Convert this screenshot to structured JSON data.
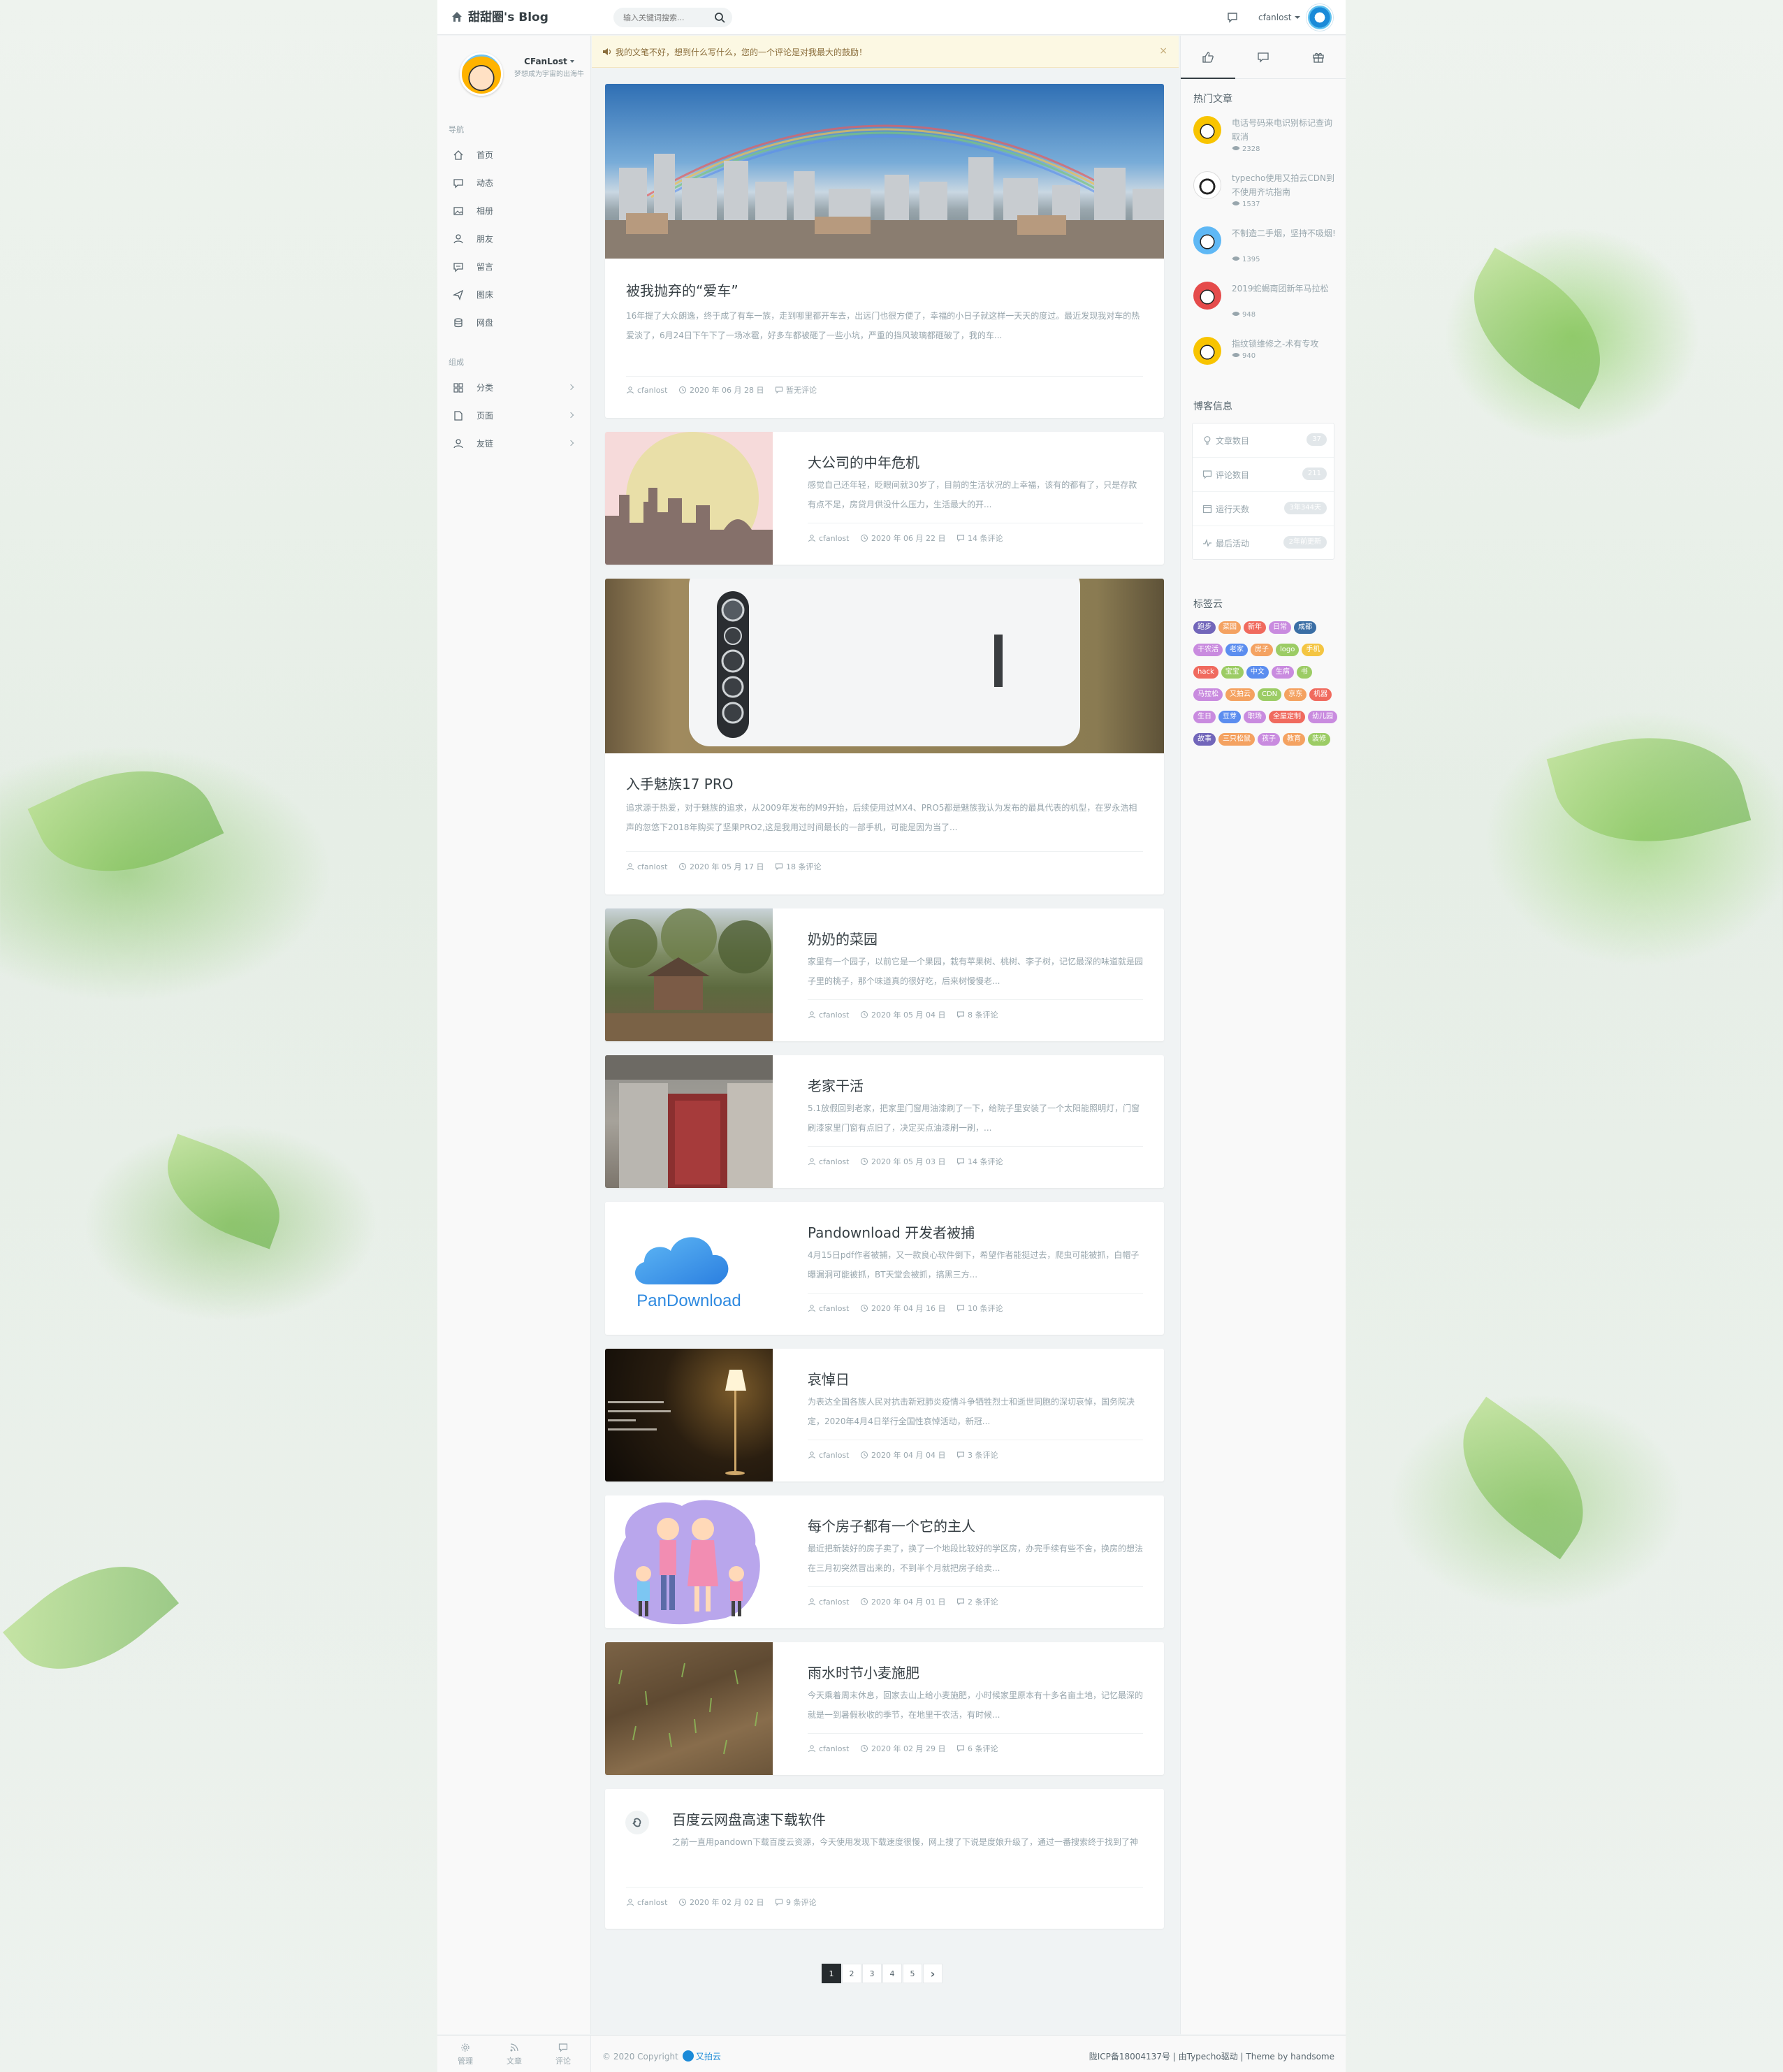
{
  "header": {
    "brand": "甜甜圈's Blog",
    "search_placeholder": "输入关键词搜索...",
    "user": "cfanlost"
  },
  "profile": {
    "name": "CFanLost",
    "bio": "梦想成为宇宙的出海牛"
  },
  "nav": {
    "section1": "导航",
    "items": [
      {
        "label": "首页",
        "icon": "home-icon"
      },
      {
        "label": "动态",
        "icon": "chat-icon"
      },
      {
        "label": "相册",
        "icon": "image-icon"
      },
      {
        "label": "朋友",
        "icon": "user-icon"
      },
      {
        "label": "留言",
        "icon": "bulb-icon"
      },
      {
        "label": "图床",
        "icon": "send-icon"
      },
      {
        "label": "网盘",
        "icon": "database-icon"
      }
    ],
    "section2": "组成",
    "groups": [
      {
        "label": "分类",
        "icon": "grid-icon"
      },
      {
        "label": "页面",
        "icon": "file-icon"
      },
      {
        "label": "友链",
        "icon": "user-icon"
      }
    ]
  },
  "notice": {
    "text": "我的文笔不好，想到什么写什么，您的一个评论是对我最大的鼓励！",
    "close": "×"
  },
  "posts": [
    {
      "title": "被我抛弃的“爱车”",
      "summary": "16年提了大众朗逸，终于成了有车一族，走到哪里都开车去，出远门也很方便了，幸福的小日子就这样一天天的度过。最近发现我对车的热爱淡了，6月24日下午下了一场冰雹，好多车都被砸了一些小坑，严重的挡风玻璃都砸破了，我的车...",
      "author": "cfanlost",
      "date": "2020 年 06 月 28 日",
      "comments": "暂无评论"
    },
    {
      "title": "大公司的中年危机",
      "summary": "感觉自己还年轻，眨眼间就30岁了，目前的生活状况的上幸福，该有的都有了，只是存款有点不足，房贷月供没什么压力，生活最大的开...",
      "author": "cfanlost",
      "date": "2020 年 06 月 22 日",
      "comments": "14 条评论"
    },
    {
      "title": "入手魅族17 PRO",
      "summary": "追求源于热爱，对于魅族的追求，从2009年发布的M9开始，后续使用过MX4、PRO5都是魅族我认为发布的最具代表的机型，在罗永浩相声的忽悠下2018年购买了坚果PRO2,这是我用过时间最长的一部手机，可能是因为当了...",
      "author": "cfanlost",
      "date": "2020 年 05 月 17 日",
      "comments": "18 条评论"
    },
    {
      "title": "奶奶的菜园",
      "summary": "家里有一个园子，以前它是一个果园，栽有苹果树、桃树、李子树，记忆最深的味道就是园子里的桃子，那个味道真的很好吃，后来树慢慢老...",
      "author": "cfanlost",
      "date": "2020 年 05 月 04 日",
      "comments": "8 条评论"
    },
    {
      "title": "老家干活",
      "summary": "5.1放假回到老家，把家里门窗用油漆刷了一下，给院子里安装了一个太阳能照明灯，门窗刷漆家里门窗有点旧了，决定买点油漆刷一刷，...",
      "author": "cfanlost",
      "date": "2020 年 05 月 03 日",
      "comments": "14 条评论"
    },
    {
      "title": "Pandownload 开发者被捕",
      "summary": "4月15日pdf作者被捕，又一款良心软件倒下，希望作者能挺过去，爬虫可能被抓，白帽子曝漏洞可能被抓，BT天堂会被抓，搞黑三方...",
      "author": "cfanlost",
      "date": "2020 年 04 月 16 日",
      "comments": "10 条评论",
      "thumb_text": "PanDownload"
    },
    {
      "title": "哀悼日",
      "summary": "为表达全国各族人民对抗击新冠肺炎疫情斗争牺牲烈士和逝世同胞的深切哀悼，国务院决定，2020年4月4日举行全国性哀悼活动，新冠...",
      "author": "cfanlost",
      "date": "2020 年 04 月 04 日",
      "comments": "3 条评论"
    },
    {
      "title": "每个房子都有一个它的主人",
      "summary": "最近把新装好的房子卖了，换了一个地段比较好的学区房，办完手续有些不舍，换房的想法在三月初突然冒出来的，不到半个月就把房子给卖...",
      "author": "cfanlost",
      "date": "2020 年 04 月 01 日",
      "comments": "2 条评论"
    },
    {
      "title": "雨水时节小麦施肥",
      "summary": "今天乘着周末休息，回家去山上给小麦施肥，小时候家里原本有十多名亩土地，记忆最深的就是一到暑假秋收的季节，在地里干农活，有时候...",
      "author": "cfanlost",
      "date": "2020 年 02 月 29 日",
      "comments": "6 条评论"
    },
    {
      "title": "百度云网盘高速下载软件",
      "summary": "之前一直用pandown下载百度云资源，今天使用发现下载速度很慢，网上搜了下说是度娘升级了，通过一番搜索终于找到了神器，特地...",
      "author": "cfanlost",
      "date": "2020 年 02 月 02 日",
      "comments": "9 条评论"
    }
  ],
  "pagination": {
    "pages": [
      "1",
      "2",
      "3",
      "4",
      "5"
    ],
    "next": "›"
  },
  "right": {
    "hot_title": "热门文章",
    "hot": [
      {
        "title": "电话号码来电识别标记查询取消",
        "views": "2328"
      },
      {
        "title": "typecho使用又拍云CDN到不使用齐坑指南",
        "views": "1537"
      },
      {
        "title": "不制造二手烟，坚持不吸烟!",
        "views": "1395"
      },
      {
        "title": "2019蛇蝎南团新年马拉松",
        "views": "948"
      },
      {
        "title": "指纹锁维修之-术有专攻",
        "views": "940"
      }
    ],
    "info_title": "博客信息",
    "stats": [
      {
        "label": "文章数目",
        "value": "37"
      },
      {
        "label": "评论数目",
        "value": "211"
      },
      {
        "label": "运行天数",
        "value": "3年344天"
      },
      {
        "label": "最后活动",
        "value": "2年前更新"
      }
    ],
    "tags_title": "标签云",
    "tags": [
      {
        "name": "跑步",
        "color": "#7266ba"
      },
      {
        "name": "菜园",
        "color": "#f4a261"
      },
      {
        "name": "新年",
        "color": "#f06a5e"
      },
      {
        "name": "日常",
        "color": "#c98bdf"
      },
      {
        "name": "成都",
        "color": "#3a6ea5"
      },
      {
        "name": "干农活",
        "color": "#c98bdf"
      },
      {
        "name": "老家",
        "color": "#5b8def"
      },
      {
        "name": "房子",
        "color": "#f4a261"
      },
      {
        "name": "logo",
        "color": "#9ccc65"
      },
      {
        "name": "手机",
        "color": "#f4c542"
      },
      {
        "name": "hack",
        "color": "#f06a5e"
      },
      {
        "name": "宝宝",
        "color": "#9ccc65"
      },
      {
        "name": "中文",
        "color": "#5b8def"
      },
      {
        "name": "生病",
        "color": "#c98bdf"
      },
      {
        "name": "书",
        "color": "#9ccc65"
      },
      {
        "name": "马拉松",
        "color": "#c98bdf"
      },
      {
        "name": "又拍云",
        "color": "#f4a261"
      },
      {
        "name": "CDN",
        "color": "#9ccc65"
      },
      {
        "name": "京东",
        "color": "#f4a261"
      },
      {
        "name": "机器",
        "color": "#f06a5e"
      },
      {
        "name": "生日",
        "color": "#c98bdf"
      },
      {
        "name": "豆芽",
        "color": "#5b8def"
      },
      {
        "name": "职场",
        "color": "#c98bdf"
      },
      {
        "name": "全屋定制",
        "color": "#f06a5e"
      },
      {
        "name": "幼儿园",
        "color": "#c98bdf"
      },
      {
        "name": "故事",
        "color": "#7266ba"
      },
      {
        "name": "三只松鼠",
        "color": "#f4a261"
      },
      {
        "name": "孩子",
        "color": "#c98bdf"
      },
      {
        "name": "教育",
        "color": "#f4a261"
      },
      {
        "name": "装修",
        "color": "#9ccc65"
      }
    ]
  },
  "footer": {
    "links": [
      "管理",
      "文章",
      "评论"
    ],
    "copyright": "© 2020 Copyright",
    "brand": "又拍云",
    "right": "陇ICP备18004137号 | 由Typecho驱动 | Theme by handsome"
  }
}
